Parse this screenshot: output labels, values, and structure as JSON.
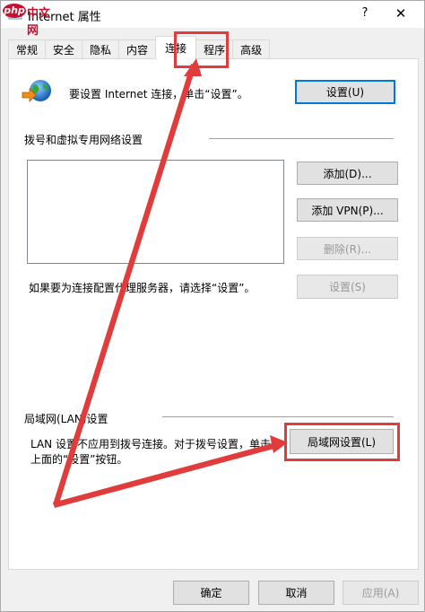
{
  "window": {
    "title": "Internet 属性",
    "help_label": "?",
    "close_label": "✕"
  },
  "logo": {
    "mark": "php",
    "text": "中文网"
  },
  "tabs": [
    {
      "label": "常规",
      "active": false
    },
    {
      "label": "安全",
      "active": false
    },
    {
      "label": "隐私",
      "active": false
    },
    {
      "label": "内容",
      "active": false
    },
    {
      "label": "连接",
      "active": true
    },
    {
      "label": "程序",
      "active": false
    },
    {
      "label": "高级",
      "active": false
    }
  ],
  "connections": {
    "intro_text": "要设置 Internet 连接，单击“设置”。",
    "setup_button": "设置(U)",
    "dialup_section_label": "拨号和虚拟专用网络设置",
    "add_button": "添加(D)...",
    "add_vpn_button": "添加 VPN(P)...",
    "remove_button": "删除(R)...",
    "proxy_text": "如果要为连接配置代理服务器，请选择“设置”。",
    "settings_button": "设置(S)",
    "lan_section_label": "局域网(LAN)设置",
    "lan_text_line1": "LAN 设置不应用到拨号连接。对于拨号设置，单击",
    "lan_text_line2": "上面的“设置”按钮。",
    "lan_settings_button": "局域网设置(L)"
  },
  "footer": {
    "ok_button": "确定",
    "cancel_button": "取消",
    "apply_button": "应用(A)"
  },
  "colors": {
    "annotation_red": "#e03c3c",
    "default_button_border": "#0078d7"
  },
  "icons": {
    "window_icon": "internet-options-icon",
    "connection_icon": "globe-network-icon"
  }
}
